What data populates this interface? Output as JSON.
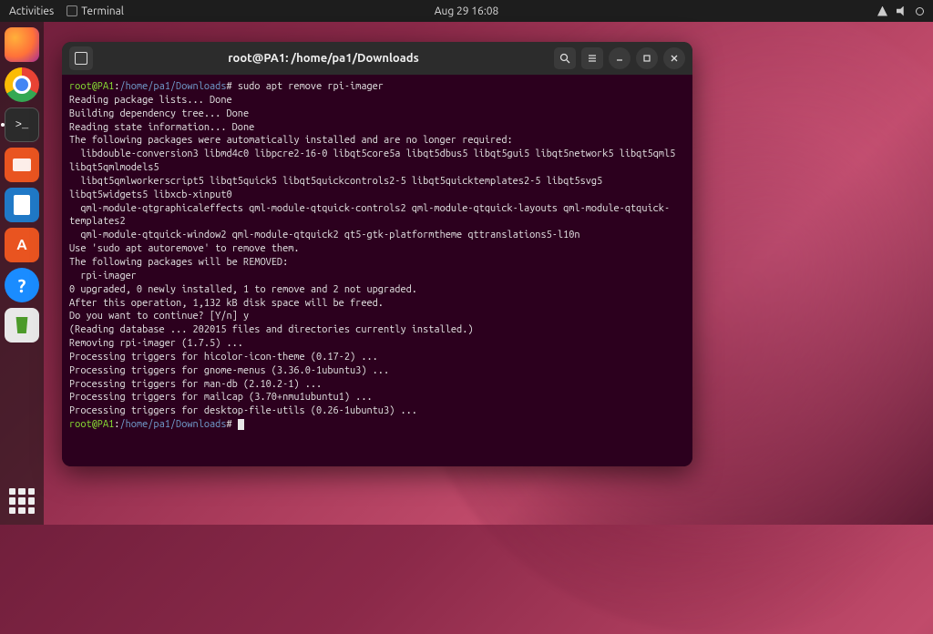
{
  "topbar": {
    "activities": "Activities",
    "app_menu": "Terminal",
    "clock": "Aug 29  16:08"
  },
  "dock": {
    "items": [
      {
        "name": "firefox-icon"
      },
      {
        "name": "chrome-icon"
      },
      {
        "name": "terminal-icon",
        "active": true
      },
      {
        "name": "files-icon"
      },
      {
        "name": "libreoffice-writer-icon"
      },
      {
        "name": "ubuntu-software-icon"
      },
      {
        "name": "help-icon"
      },
      {
        "name": "trash-icon"
      }
    ]
  },
  "window": {
    "title": "root@PA1: /home/pa1/Downloads",
    "prompt_user_host": "root@PA1",
    "prompt_path": "/home/pa1/Downloads",
    "command": "sudo apt remove rpi-imager",
    "lines": [
      "Reading package lists... Done",
      "Building dependency tree... Done",
      "Reading state information... Done",
      "The following packages were automatically installed and are no longer required:",
      "  libdouble-conversion3 libmd4c0 libpcre2-16-0 libqt5core5a libqt5dbus5 libqt5gui5 libqt5network5 libqt5qml5 libqt5qmlmodels5",
      "  libqt5qmlworkerscript5 libqt5quick5 libqt5quickcontrols2-5 libqt5quicktemplates2-5 libqt5svg5 libqt5widgets5 libxcb-xinput0",
      "  qml-module-qtgraphicaleffects qml-module-qtquick-controls2 qml-module-qtquick-layouts qml-module-qtquick-templates2",
      "  qml-module-qtquick-window2 qml-module-qtquick2 qt5-gtk-platformtheme qttranslations5-l10n",
      "Use 'sudo apt autoremove' to remove them.",
      "The following packages will be REMOVED:",
      "  rpi-imager",
      "0 upgraded, 0 newly installed, 1 to remove and 2 not upgraded.",
      "After this operation, 1,132 kB disk space will be freed.",
      "Do you want to continue? [Y/n] y",
      "(Reading database ... 202015 files and directories currently installed.)",
      "Removing rpi-imager (1.7.5) ...",
      "Processing triggers for hicolor-icon-theme (0.17-2) ...",
      "Processing triggers for gnome-menus (3.36.0-1ubuntu3) ...",
      "Processing triggers for man-db (2.10.2-1) ...",
      "Processing triggers for mailcap (3.70+nmu1ubuntu1) ...",
      "Processing triggers for desktop-file-utils (0.26-1ubuntu3) ..."
    ]
  }
}
